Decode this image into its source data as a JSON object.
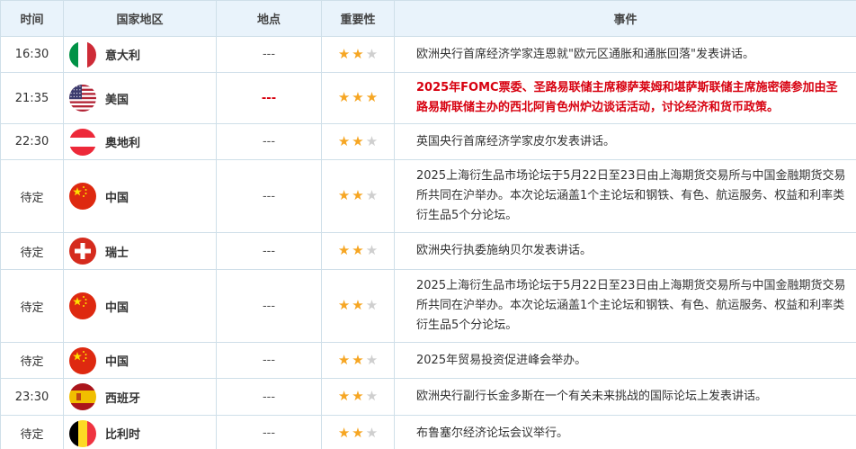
{
  "colors": {
    "header_bg": "#e9f3fb",
    "border": "#cfdfe9",
    "star_on": "#f6a623",
    "star_off": "#cfcfcf",
    "highlight": "#d7000f"
  },
  "header": {
    "time": "时间",
    "country": "国家地区",
    "place": "地点",
    "importance": "重要性",
    "event": "事件"
  },
  "rows": [
    {
      "time": "16:30",
      "country": "意大利",
      "flag": "italy-flag-icon",
      "place": "---",
      "stars": 2,
      "event": "欧洲央行首席经济学家连恩就\"欧元区通胀和通胀回落\"发表讲话。",
      "highlight": false
    },
    {
      "time": "21:35",
      "country": "美国",
      "flag": "usa-flag-icon",
      "place": "---",
      "stars": 3,
      "event": "2025年FOMC票委、圣路易联储主席穆萨莱姆和堪萨斯联储主席施密德参加由圣路易斯联储主办的西北阿肯色州炉边谈话活动，讨论经济和货币政策。",
      "highlight": true
    },
    {
      "time": "22:30",
      "country": "奥地利",
      "flag": "austria-flag-icon",
      "place": "---",
      "stars": 2,
      "event": "英国央行首席经济学家皮尔发表讲话。",
      "highlight": false
    },
    {
      "time": "待定",
      "country": "中国",
      "flag": "china-flag-icon",
      "place": "---",
      "stars": 2,
      "event": "2025上海衍生品市场论坛于5月22日至23日由上海期货交易所与中国金融期货交易所共同在沪举办。本次论坛涵盖1个主论坛和钢铁、有色、航运服务、权益和利率类衍生品5个分论坛。",
      "highlight": false
    },
    {
      "time": "待定",
      "country": "瑞士",
      "flag": "switzerland-flag-icon",
      "place": "---",
      "stars": 2,
      "event": "欧洲央行执委施纳贝尔发表讲话。",
      "highlight": false
    },
    {
      "time": "待定",
      "country": "中国",
      "flag": "china-flag-icon",
      "place": "---",
      "stars": 2,
      "event": "2025上海衍生品市场论坛于5月22日至23日由上海期货交易所与中国金融期货交易所共同在沪举办。本次论坛涵盖1个主论坛和钢铁、有色、航运服务、权益和利率类衍生品5个分论坛。",
      "highlight": false
    },
    {
      "time": "待定",
      "country": "中国",
      "flag": "china-flag-icon",
      "place": "---",
      "stars": 2,
      "event": "2025年贸易投资促进峰会举办。",
      "highlight": false
    },
    {
      "time": "23:30",
      "country": "西班牙",
      "flag": "spain-flag-icon",
      "place": "---",
      "stars": 2,
      "event": "欧洲央行副行长金多斯在一个有关未来挑战的国际论坛上发表讲话。",
      "highlight": false
    },
    {
      "time": "待定",
      "country": "比利时",
      "flag": "belgium-flag-icon",
      "place": "---",
      "stars": 2,
      "event": "布鲁塞尔经济论坛会议举行。",
      "highlight": false
    }
  ]
}
